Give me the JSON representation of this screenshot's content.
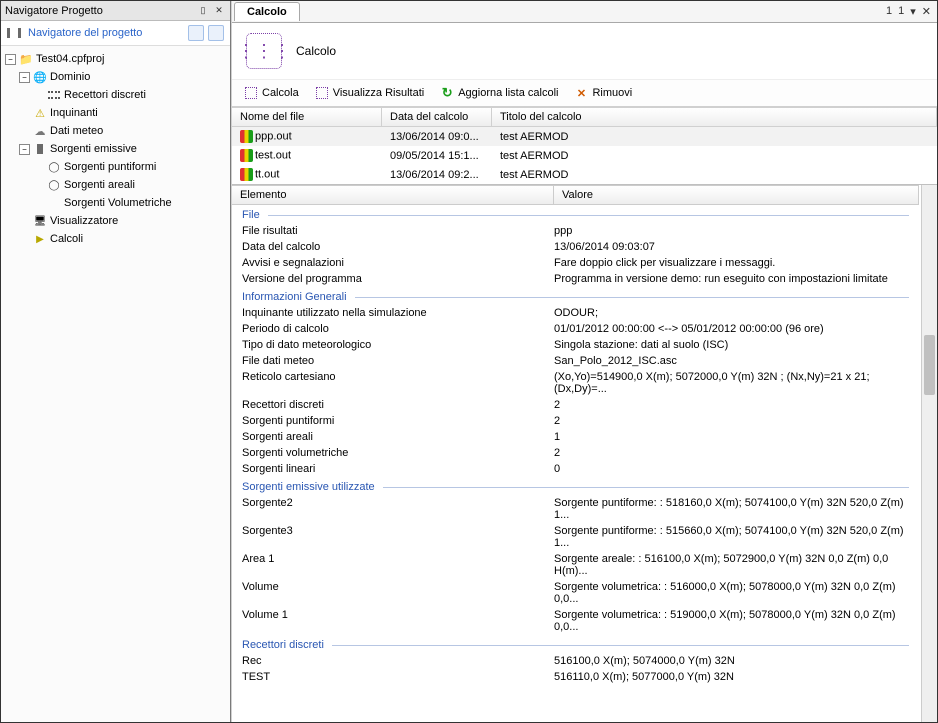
{
  "leftPanel": {
    "title": "Navigatore Progetto",
    "link": "Navigatore del progetto"
  },
  "tree": {
    "root": "Test04.cpfproj",
    "dominio": "Dominio",
    "recettori": "Recettori discreti",
    "inquinanti": "Inquinanti",
    "meteo": "Dati meteo",
    "sorgenti": "Sorgenti emissive",
    "punti": "Sorgenti puntiformi",
    "areali": "Sorgenti areali",
    "volum": "Sorgenti Volumetriche",
    "visual": "Visualizzatore",
    "calcoli": "Calcoli"
  },
  "tab": {
    "label": "Calcolo",
    "big": "Calcolo"
  },
  "toolbar": {
    "calcola": "Calcola",
    "visual": "Visualizza Risultati",
    "aggiorna": "Aggiorna lista calcoli",
    "rimuovi": "Rimuovi"
  },
  "cols": {
    "name": "Nome del file",
    "date": "Data del calcolo",
    "title": "Titolo del calcolo"
  },
  "files": [
    {
      "name": "ppp.out",
      "date": "13/06/2014 09:0...",
      "title": "test AERMOD"
    },
    {
      "name": "test.out",
      "date": "09/05/2014 15:1...",
      "title": "test AERMOD"
    },
    {
      "name": "tt.out",
      "date": "13/06/2014 09:2...",
      "title": "test AERMOD"
    }
  ],
  "detHead": {
    "el": "Elemento",
    "val": "Valore"
  },
  "sections": {
    "file": {
      "title": "File",
      "rows": [
        [
          "File risultati",
          "ppp"
        ],
        [
          "Data del calcolo",
          "13/06/2014 09:03:07"
        ],
        [
          "Avvisi e segnalazioni",
          "Fare doppio click per visualizzare i messaggi."
        ],
        [
          "Versione del programma",
          "Programma in versione demo: run eseguito con impostazioni limitate"
        ]
      ]
    },
    "info": {
      "title": "Informazioni Generali",
      "rows": [
        [
          "Inquinante utilizzato nella simulazione",
          "ODOUR;"
        ],
        [
          "Periodo di calcolo",
          "01/01/2012 00:00:00 <--> 05/01/2012 00:00:00 (96 ore)"
        ],
        [
          "Tipo di dato meteorologico",
          "Singola stazione: dati al suolo (ISC)"
        ],
        [
          "File dati meteo",
          "San_Polo_2012_ISC.asc"
        ],
        [
          "Reticolo cartesiano",
          "(Xo,Yo)=514900,0 X(m); 5072000,0 Y(m) 32N ; (Nx,Ny)=21 x 21; (Dx,Dy)=..."
        ],
        [
          "Recettori discreti",
          "2"
        ],
        [
          "Sorgenti puntiformi",
          "2"
        ],
        [
          "Sorgenti areali",
          "1"
        ],
        [
          "Sorgenti volumetriche",
          "2"
        ],
        [
          "Sorgenti lineari",
          "0"
        ]
      ]
    },
    "sorg": {
      "title": "Sorgenti emissive utilizzate",
      "rows": [
        [
          "Sorgente2",
          "Sorgente puntiforme: : 518160,0 X(m); 5074100,0 Y(m) 32N  520,0 Z(m) 1..."
        ],
        [
          "Sorgente3",
          "Sorgente puntiforme: : 515660,0 X(m); 5074100,0 Y(m) 32N  520,0 Z(m) 1..."
        ],
        [
          "Area  1",
          "Sorgente areale: : 516100,0 X(m); 5072900,0 Y(m) 32N  0,0 Z(m) 0,0 H(m)..."
        ],
        [
          "Volume",
          "Sorgente volumetrica: : 516000,0 X(m); 5078000,0 Y(m) 32N  0,0 Z(m) 0,0..."
        ],
        [
          "Volume 1",
          "Sorgente volumetrica: : 519000,0 X(m); 5078000,0 Y(m) 32N  0,0 Z(m) 0,0..."
        ]
      ]
    },
    "rec": {
      "title": "Recettori discreti",
      "rows": [
        [
          "Rec",
          "516100,0 X(m); 5074000,0 Y(m) 32N"
        ],
        [
          "TEST",
          "516110,0 X(m); 5077000,0 Y(m) 32N"
        ]
      ]
    }
  }
}
